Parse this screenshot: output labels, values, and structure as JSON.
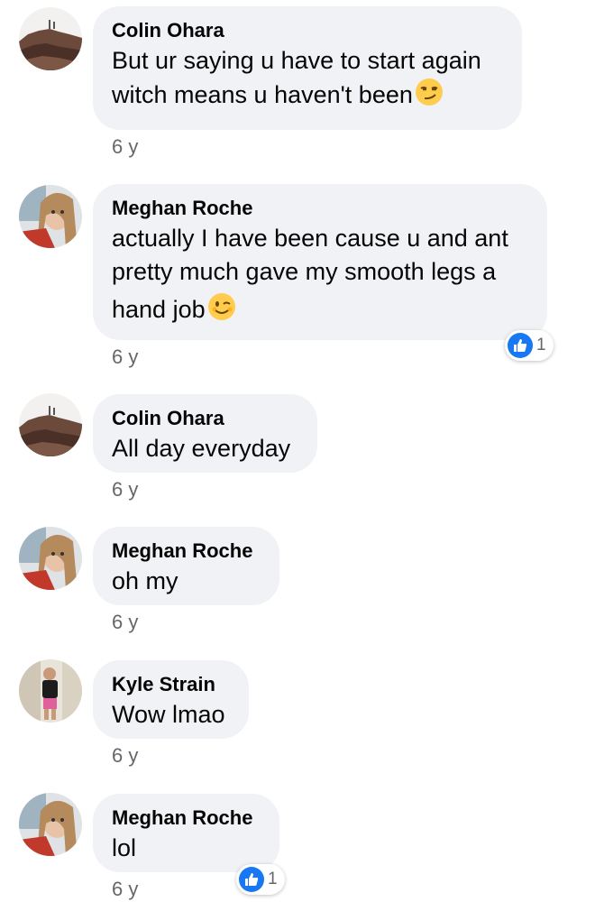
{
  "comments": [
    {
      "author": "Colin Ohara",
      "lines": [
        "But ur saying u have to start again",
        "witch means u haven't been"
      ],
      "emoji": "smirk-emoji",
      "time": "6 y",
      "avatar": "rock-landscape"
    },
    {
      "author": "Meghan Roche",
      "lines": [
        "actually I have been cause u and ant",
        "pretty much gave my smooth legs a",
        "hand job"
      ],
      "emoji": "wink-emoji",
      "time": "6 y",
      "reactions": {
        "type": "like",
        "count": "1"
      },
      "avatar": "selfie-girl"
    },
    {
      "author": "Colin Ohara",
      "lines": [
        "All day everyday"
      ],
      "time": "6 y",
      "avatar": "rock-landscape"
    },
    {
      "author": "Meghan Roche",
      "lines": [
        "oh my"
      ],
      "time": "6 y",
      "avatar": "selfie-girl"
    },
    {
      "author": "Kyle Strain",
      "lines": [
        "Wow lmao"
      ],
      "time": "6 y",
      "avatar": "standing-person"
    },
    {
      "author": "Meghan Roche",
      "lines": [
        "lol"
      ],
      "time": "6 y",
      "reactions": {
        "type": "like",
        "count": "1"
      },
      "avatar": "selfie-girl"
    }
  ],
  "colors": {
    "bubble": "#f0f2f5",
    "timestamp": "#65676b",
    "like": "#1877f2"
  }
}
